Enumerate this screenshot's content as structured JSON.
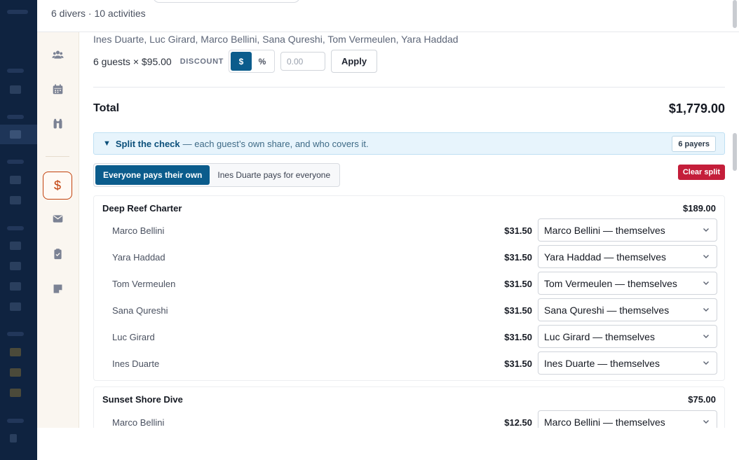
{
  "header": {
    "subtitle": "6 divers · 10 activities"
  },
  "rail": {
    "items": [
      {
        "name": "guests-icon"
      },
      {
        "name": "calendar-icon"
      },
      {
        "name": "gear-icon"
      },
      {
        "name": "dollar-icon",
        "glyph": "$",
        "active": true
      },
      {
        "name": "mail-icon"
      },
      {
        "name": "clipboard-icon"
      },
      {
        "name": "note-icon"
      }
    ]
  },
  "pricing": {
    "guest_names": "Ines Duarte, Luc Girard, Marco Bellini, Sana Qureshi, Tom Vermeulen, Yara Haddad",
    "calc": "6 guests × $95.00",
    "discount_label": "DISCOUNT",
    "discount_modes": [
      "$",
      "%"
    ],
    "discount_mode_selected": "$",
    "discount_placeholder": "0.00",
    "apply_label": "Apply"
  },
  "total": {
    "label": "Total",
    "value": "$1,779.00"
  },
  "split": {
    "toggle_glyph": "▼",
    "title": "Split the check",
    "description": "— each guest’s own share, and who covers it.",
    "payers_badge": "6 payers",
    "modes": [
      "Everyone pays their own",
      "Ines Duarte pays for everyone"
    ],
    "mode_selected": "Everyone pays their own",
    "clear_label": "Clear split"
  },
  "activities": [
    {
      "name": "Deep Reef Charter",
      "total": "$189.00",
      "shares": [
        {
          "guest": "Marco Bellini",
          "amount": "$31.50",
          "payer": "Marco Bellini — themselves"
        },
        {
          "guest": "Yara Haddad",
          "amount": "$31.50",
          "payer": "Yara Haddad — themselves"
        },
        {
          "guest": "Tom Vermeulen",
          "amount": "$31.50",
          "payer": "Tom Vermeulen — themselves"
        },
        {
          "guest": "Sana Qureshi",
          "amount": "$31.50",
          "payer": "Sana Qureshi — themselves"
        },
        {
          "guest": "Luc Girard",
          "amount": "$31.50",
          "payer": "Luc Girard — themselves"
        },
        {
          "guest": "Ines Duarte",
          "amount": "$31.50",
          "payer": "Ines Duarte — themselves"
        }
      ]
    },
    {
      "name": "Sunset Shore Dive",
      "total": "$75.00",
      "shares": [
        {
          "guest": "Marco Bellini",
          "amount": "$12.50",
          "payer": "Marco Bellini — themselves"
        }
      ]
    }
  ],
  "colors": {
    "accent": "#0b5c8c",
    "danger": "#c41e3a",
    "rail_active": "#c2410c",
    "split_bar_bg": "#e7f4fc",
    "background_app": "#0f2340"
  }
}
